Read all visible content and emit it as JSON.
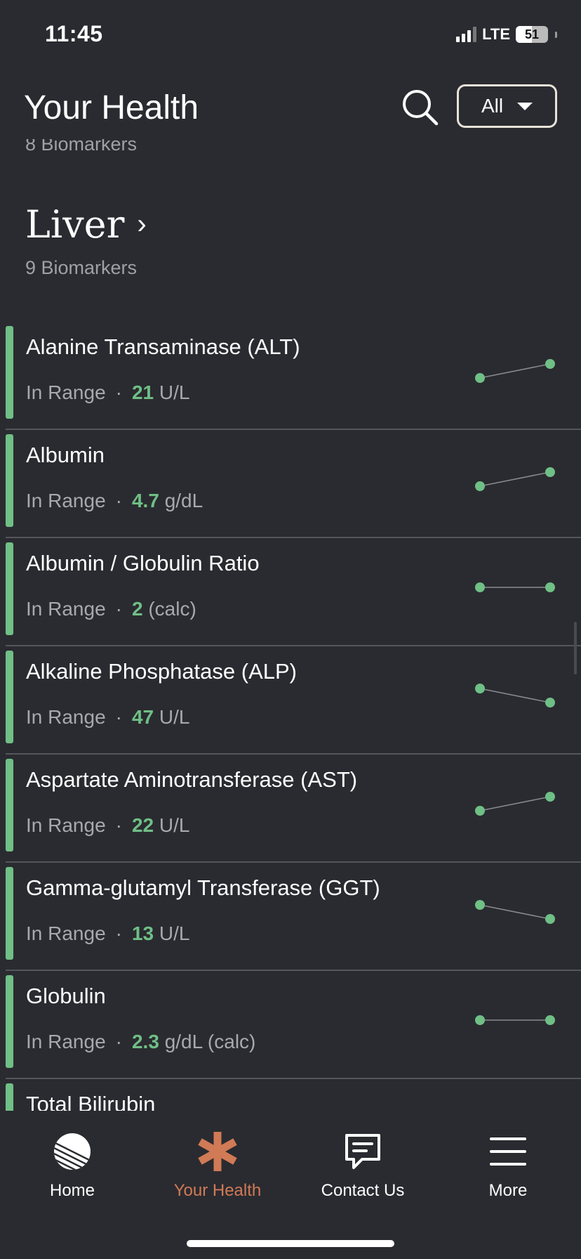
{
  "status_bar": {
    "time": "11:45",
    "network": "LTE",
    "battery": "51"
  },
  "header": {
    "title": "Your Health",
    "filter_label": "All"
  },
  "previous_section": {
    "count": "8 Biomarkers"
  },
  "section": {
    "title": "Liver",
    "count": "9 Biomarkers"
  },
  "colors": {
    "in_range": "#6fbf86",
    "accent": "#d07a56",
    "background": "#2a2b30"
  },
  "biomarkers": [
    {
      "name": "Alanine Transaminase (ALT)",
      "status": "In Range",
      "value": "21",
      "unit": "U/L",
      "trend": "up"
    },
    {
      "name": "Albumin",
      "status": "In Range",
      "value": "4.7",
      "unit": "g/dL",
      "trend": "up"
    },
    {
      "name": "Albumin / Globulin Ratio",
      "status": "In Range",
      "value": "2",
      "unit": "(calc)",
      "trend": "flat"
    },
    {
      "name": "Alkaline Phosphatase (ALP)",
      "status": "In Range",
      "value": "47",
      "unit": "U/L",
      "trend": "down"
    },
    {
      "name": "Aspartate Aminotransferase (AST)",
      "status": "In Range",
      "value": "22",
      "unit": "U/L",
      "trend": "up"
    },
    {
      "name": "Gamma-glutamyl Transferase (GGT)",
      "status": "In Range",
      "value": "13",
      "unit": "U/L",
      "trend": "down"
    },
    {
      "name": "Globulin",
      "status": "In Range",
      "value": "2.3",
      "unit": "g/dL (calc)",
      "trend": "flat"
    },
    {
      "name": "Total Bilirubin",
      "status": "",
      "value": "",
      "unit": "",
      "trend": ""
    }
  ],
  "tabbar": {
    "items": [
      {
        "label": "Home",
        "icon": "home-icon"
      },
      {
        "label": "Your Health",
        "icon": "asterisk-icon"
      },
      {
        "label": "Contact Us",
        "icon": "chat-icon"
      },
      {
        "label": "More",
        "icon": "menu-icon"
      }
    ],
    "active": "Your Health"
  }
}
